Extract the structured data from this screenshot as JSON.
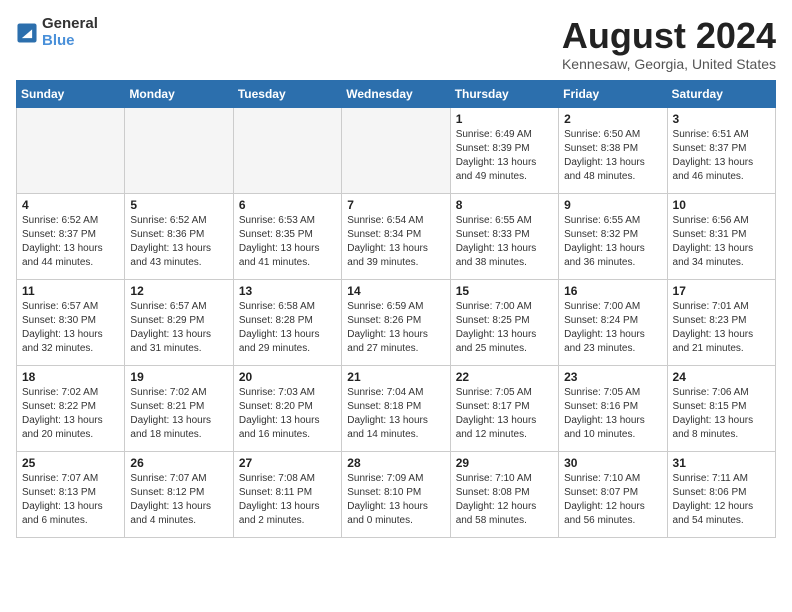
{
  "logo": {
    "text_general": "General",
    "text_blue": "Blue"
  },
  "title": "August 2024",
  "subtitle": "Kennesaw, Georgia, United States",
  "days_of_week": [
    "Sunday",
    "Monday",
    "Tuesday",
    "Wednesday",
    "Thursday",
    "Friday",
    "Saturday"
  ],
  "weeks": [
    [
      {
        "day": "",
        "info": ""
      },
      {
        "day": "",
        "info": ""
      },
      {
        "day": "",
        "info": ""
      },
      {
        "day": "",
        "info": ""
      },
      {
        "day": "1",
        "info": "Sunrise: 6:49 AM\nSunset: 8:39 PM\nDaylight: 13 hours and 49 minutes."
      },
      {
        "day": "2",
        "info": "Sunrise: 6:50 AM\nSunset: 8:38 PM\nDaylight: 13 hours and 48 minutes."
      },
      {
        "day": "3",
        "info": "Sunrise: 6:51 AM\nSunset: 8:37 PM\nDaylight: 13 hours and 46 minutes."
      }
    ],
    [
      {
        "day": "4",
        "info": "Sunrise: 6:52 AM\nSunset: 8:37 PM\nDaylight: 13 hours and 44 minutes."
      },
      {
        "day": "5",
        "info": "Sunrise: 6:52 AM\nSunset: 8:36 PM\nDaylight: 13 hours and 43 minutes."
      },
      {
        "day": "6",
        "info": "Sunrise: 6:53 AM\nSunset: 8:35 PM\nDaylight: 13 hours and 41 minutes."
      },
      {
        "day": "7",
        "info": "Sunrise: 6:54 AM\nSunset: 8:34 PM\nDaylight: 13 hours and 39 minutes."
      },
      {
        "day": "8",
        "info": "Sunrise: 6:55 AM\nSunset: 8:33 PM\nDaylight: 13 hours and 38 minutes."
      },
      {
        "day": "9",
        "info": "Sunrise: 6:55 AM\nSunset: 8:32 PM\nDaylight: 13 hours and 36 minutes."
      },
      {
        "day": "10",
        "info": "Sunrise: 6:56 AM\nSunset: 8:31 PM\nDaylight: 13 hours and 34 minutes."
      }
    ],
    [
      {
        "day": "11",
        "info": "Sunrise: 6:57 AM\nSunset: 8:30 PM\nDaylight: 13 hours and 32 minutes."
      },
      {
        "day": "12",
        "info": "Sunrise: 6:57 AM\nSunset: 8:29 PM\nDaylight: 13 hours and 31 minutes."
      },
      {
        "day": "13",
        "info": "Sunrise: 6:58 AM\nSunset: 8:28 PM\nDaylight: 13 hours and 29 minutes."
      },
      {
        "day": "14",
        "info": "Sunrise: 6:59 AM\nSunset: 8:26 PM\nDaylight: 13 hours and 27 minutes."
      },
      {
        "day": "15",
        "info": "Sunrise: 7:00 AM\nSunset: 8:25 PM\nDaylight: 13 hours and 25 minutes."
      },
      {
        "day": "16",
        "info": "Sunrise: 7:00 AM\nSunset: 8:24 PM\nDaylight: 13 hours and 23 minutes."
      },
      {
        "day": "17",
        "info": "Sunrise: 7:01 AM\nSunset: 8:23 PM\nDaylight: 13 hours and 21 minutes."
      }
    ],
    [
      {
        "day": "18",
        "info": "Sunrise: 7:02 AM\nSunset: 8:22 PM\nDaylight: 13 hours and 20 minutes."
      },
      {
        "day": "19",
        "info": "Sunrise: 7:02 AM\nSunset: 8:21 PM\nDaylight: 13 hours and 18 minutes."
      },
      {
        "day": "20",
        "info": "Sunrise: 7:03 AM\nSunset: 8:20 PM\nDaylight: 13 hours and 16 minutes."
      },
      {
        "day": "21",
        "info": "Sunrise: 7:04 AM\nSunset: 8:18 PM\nDaylight: 13 hours and 14 minutes."
      },
      {
        "day": "22",
        "info": "Sunrise: 7:05 AM\nSunset: 8:17 PM\nDaylight: 13 hours and 12 minutes."
      },
      {
        "day": "23",
        "info": "Sunrise: 7:05 AM\nSunset: 8:16 PM\nDaylight: 13 hours and 10 minutes."
      },
      {
        "day": "24",
        "info": "Sunrise: 7:06 AM\nSunset: 8:15 PM\nDaylight: 13 hours and 8 minutes."
      }
    ],
    [
      {
        "day": "25",
        "info": "Sunrise: 7:07 AM\nSunset: 8:13 PM\nDaylight: 13 hours and 6 minutes."
      },
      {
        "day": "26",
        "info": "Sunrise: 7:07 AM\nSunset: 8:12 PM\nDaylight: 13 hours and 4 minutes."
      },
      {
        "day": "27",
        "info": "Sunrise: 7:08 AM\nSunset: 8:11 PM\nDaylight: 13 hours and 2 minutes."
      },
      {
        "day": "28",
        "info": "Sunrise: 7:09 AM\nSunset: 8:10 PM\nDaylight: 13 hours and 0 minutes."
      },
      {
        "day": "29",
        "info": "Sunrise: 7:10 AM\nSunset: 8:08 PM\nDaylight: 12 hours and 58 minutes."
      },
      {
        "day": "30",
        "info": "Sunrise: 7:10 AM\nSunset: 8:07 PM\nDaylight: 12 hours and 56 minutes."
      },
      {
        "day": "31",
        "info": "Sunrise: 7:11 AM\nSunset: 8:06 PM\nDaylight: 12 hours and 54 minutes."
      }
    ]
  ]
}
